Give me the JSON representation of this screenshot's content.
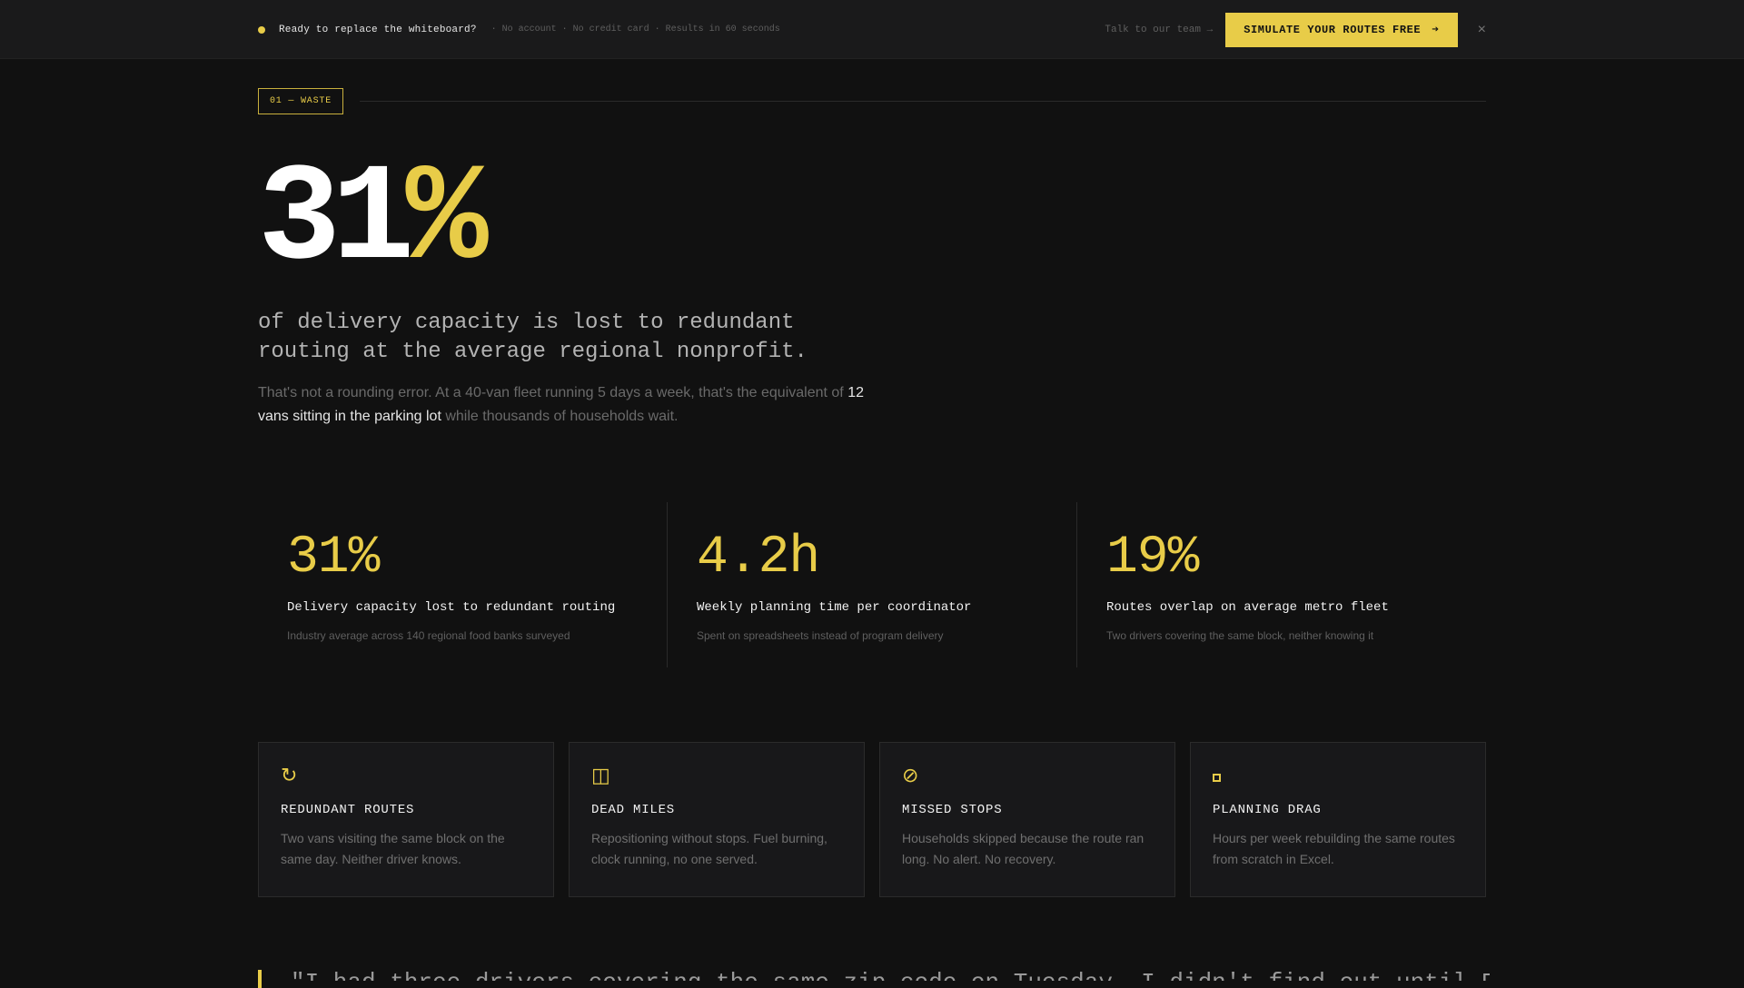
{
  "colors": {
    "accent": "#e8cc48",
    "background": "#111111",
    "banner": "#1a1a1b",
    "card": "#18181a"
  },
  "banner": {
    "title": "Ready to replace the whiteboard?",
    "meta": "· No account · No credit card · Results in 60 seconds",
    "talk": "Talk to our team →",
    "cta_label": "SIMULATE YOUR ROUTES FREE",
    "cta_arrow": "➔",
    "close": "×"
  },
  "section": {
    "tag": "01 — WASTE"
  },
  "hero": {
    "number": "31",
    "percent": "%",
    "lead": "of delivery capacity is lost to redundant routing at the average regional nonprofit.",
    "body_pre": "That's not a rounding error. At a 40-van fleet running 5 days a week, that's the equivalent of ",
    "body_highlight": "12 vans sitting in the parking lot",
    "body_post": " while thousands of households wait."
  },
  "stats": [
    {
      "value": "31%",
      "label": "Delivery capacity lost to redundant routing",
      "note": "Industry average across 140 regional food banks surveyed"
    },
    {
      "value": "4.2h",
      "label": "Weekly planning time per coordinator",
      "note": "Spent on spreadsheets instead of program delivery"
    },
    {
      "value": "19%",
      "label": "Routes overlap on average metro fleet",
      "note": "Two drivers covering the same block, neither knowing it"
    }
  ],
  "cards": [
    {
      "icon": "refresh-icon",
      "glyph": "↻",
      "title": "REDUNDANT ROUTES",
      "desc": "Two vans visiting the same block on the same day. Neither driver knows."
    },
    {
      "icon": "columns-icon",
      "glyph": "◫",
      "title": "DEAD MILES",
      "desc": "Repositioning without stops. Fuel burning, clock running, no one served."
    },
    {
      "icon": "prohibited-icon",
      "glyph": "⊘",
      "title": "MISSED STOPS",
      "desc": "Households skipped because the route ran long. No alert. No recovery."
    },
    {
      "icon": "square-icon",
      "glyph": "",
      "title": "PLANNING DRAG",
      "desc": "Hours per week rebuilding the same routes from scratch in Excel."
    }
  ],
  "quote": {
    "text": "\"I had three drivers covering the same zip code on Tuesday. I didn't find out until Friday.\""
  }
}
